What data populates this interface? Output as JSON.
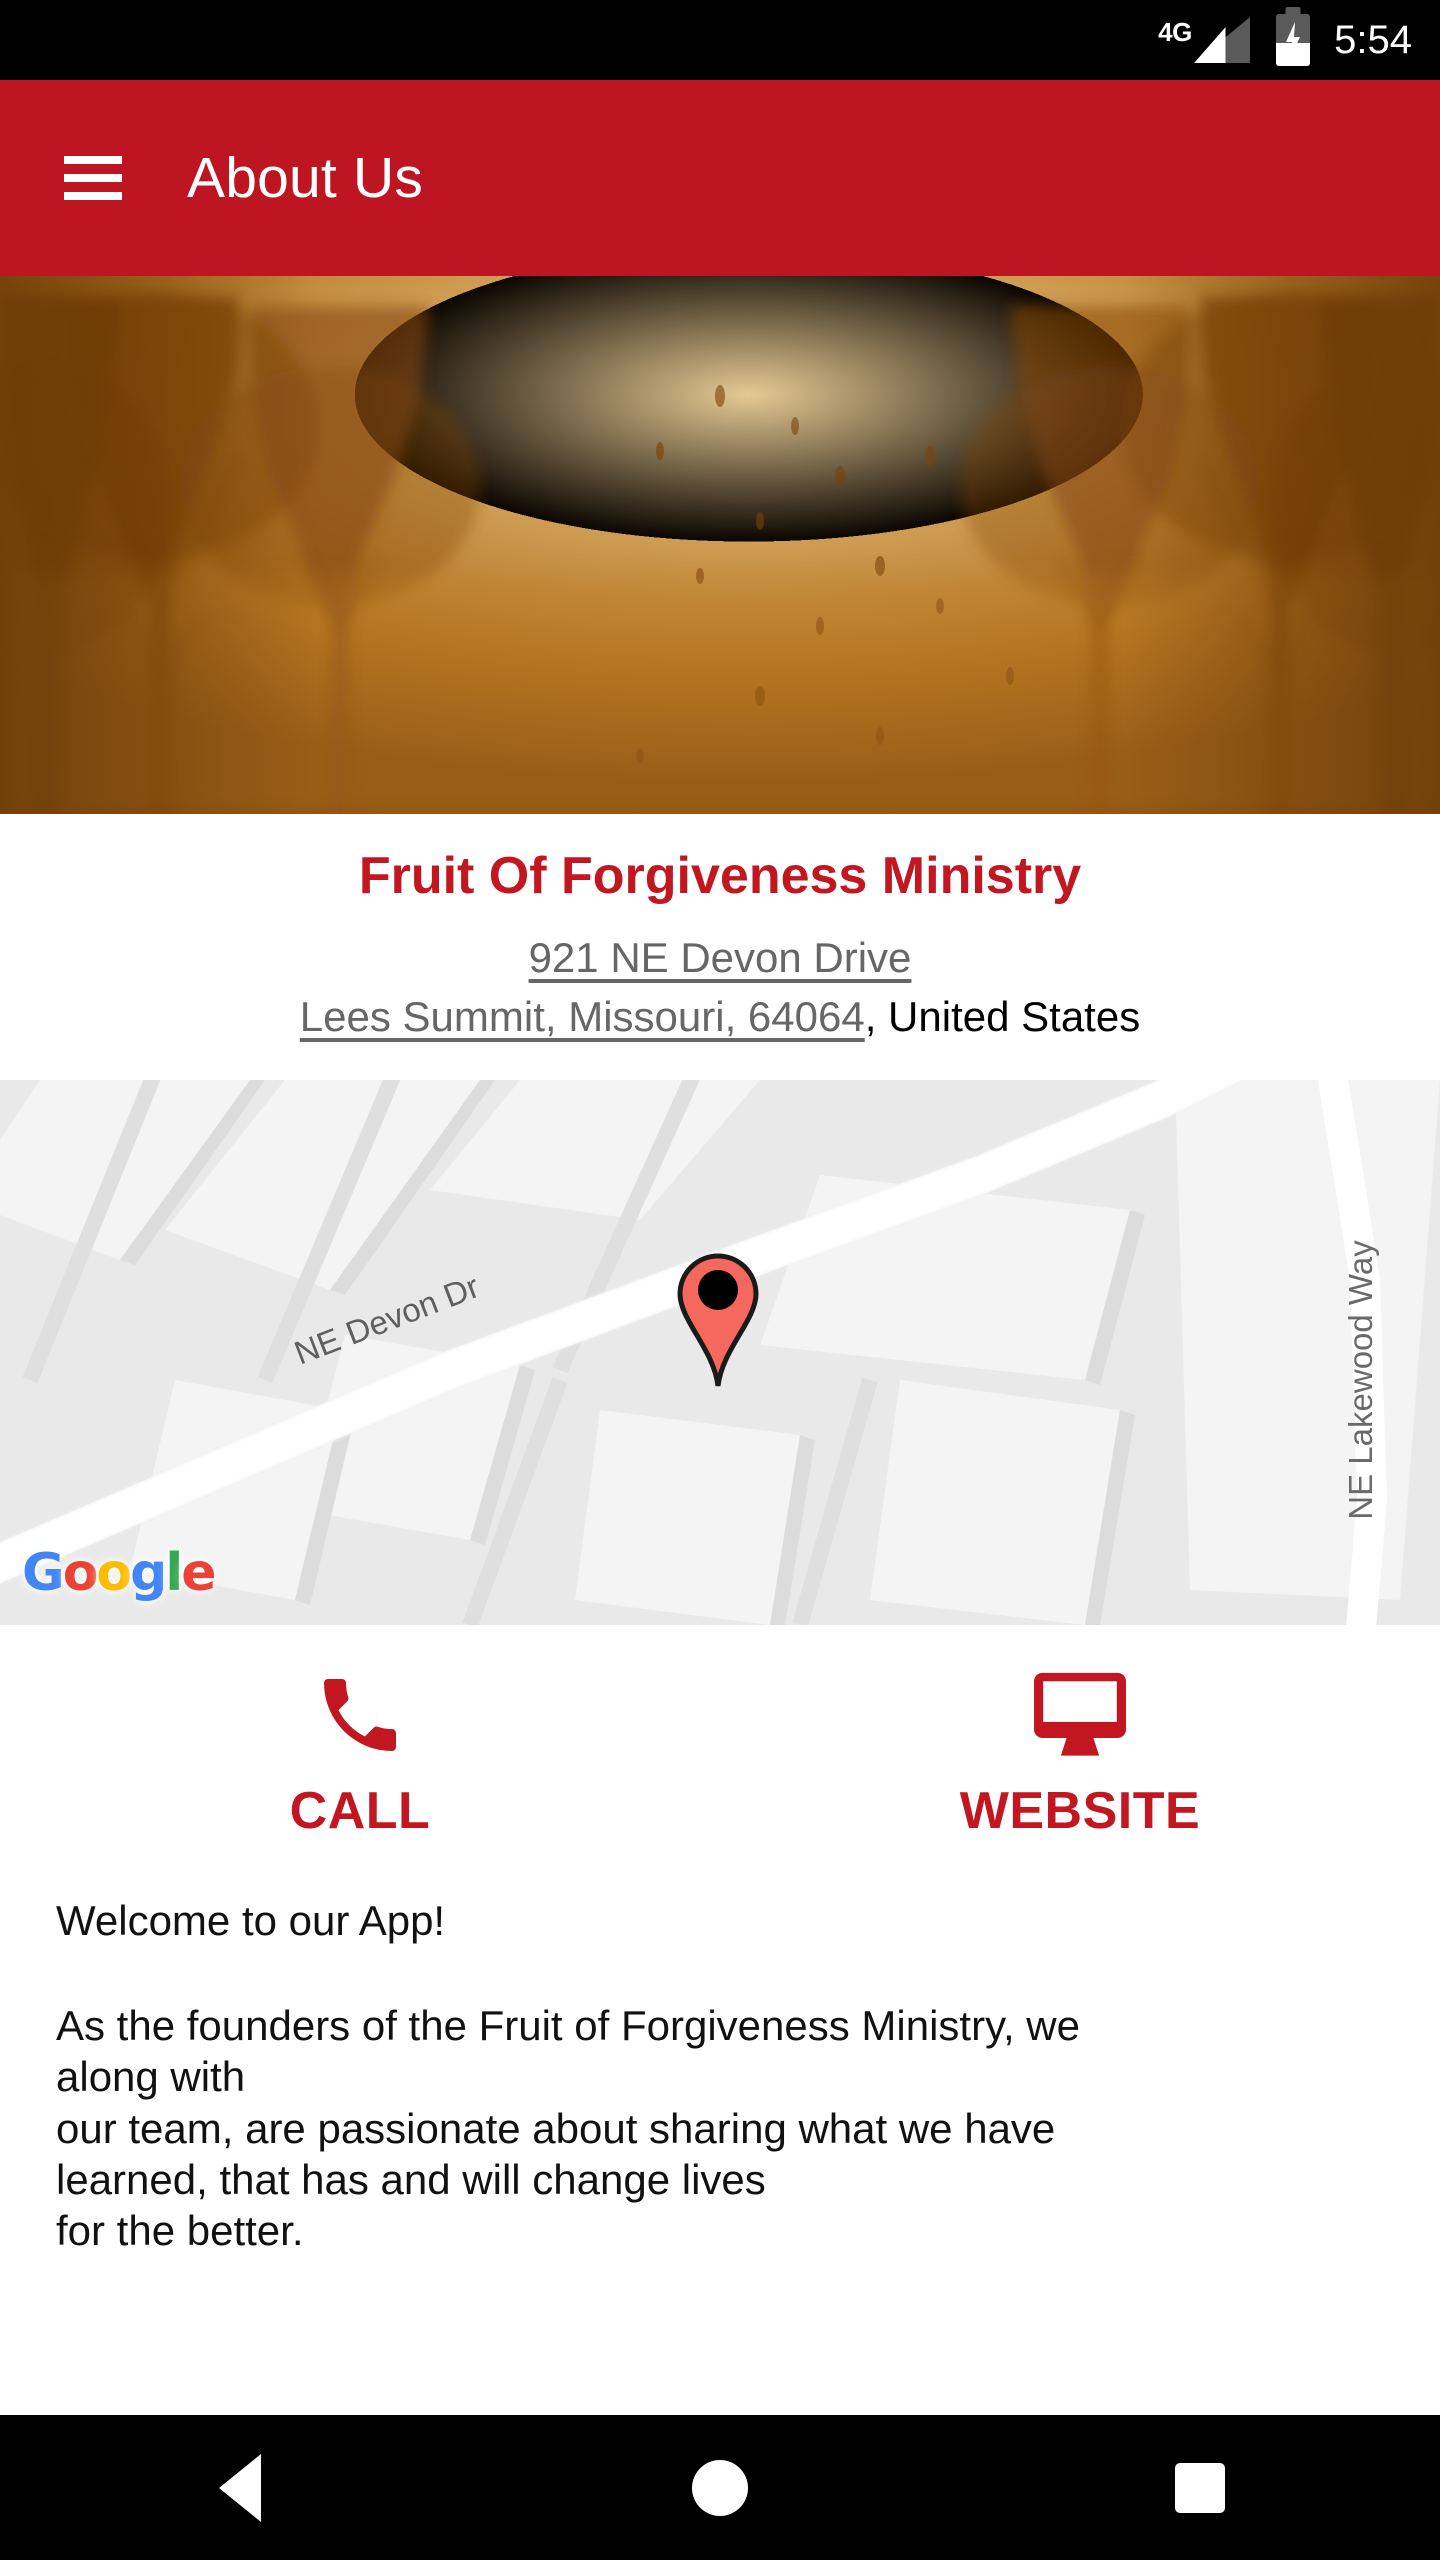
{
  "status_bar": {
    "network_type": "4G",
    "signal_icon": "signal-bars-icon",
    "battery_icon": "battery-charging-icon",
    "time": "5:54"
  },
  "app_bar": {
    "menu_icon": "hamburger-menu-icon",
    "title": "About Us",
    "background_color": "#bd1622"
  },
  "hero": {
    "alt": "autumn-trees-sepia-banner"
  },
  "organization": {
    "name": "Fruit Of Forgiveness Ministry",
    "name_color": "#c21620",
    "address_line1": "921 NE Devon Drive",
    "address_line2_link": "Lees Summit, Missouri, 64064",
    "address_line2_country": ", United States"
  },
  "map": {
    "provider_logo": "Google",
    "provider_letters": [
      "G",
      "o",
      "o",
      "g",
      "l",
      "e"
    ],
    "street_label_primary": "NE Devon Dr",
    "street_label_secondary": "NE Lakewood Way",
    "marker_icon": "map-pin-icon",
    "marker_color": "#F4685E"
  },
  "actions": [
    {
      "id": "call",
      "icon": "phone-icon",
      "label": "CALL",
      "color": "#c21620"
    },
    {
      "id": "website",
      "icon": "monitor-icon",
      "label": "WEBSITE",
      "color": "#c21620"
    }
  ],
  "body": {
    "greeting": "Welcome to our App!",
    "paragraph_lines": [
      "As the founders of the Fruit of Forgiveness Ministry, we",
      "along with",
      "our team, are passionate about sharing what we have",
      "learned, that has and will change lives",
      "for the better."
    ]
  },
  "nav_bar": {
    "back_icon": "back-triangle-icon",
    "home_icon": "home-circle-icon",
    "recents_icon": "recents-square-icon"
  }
}
